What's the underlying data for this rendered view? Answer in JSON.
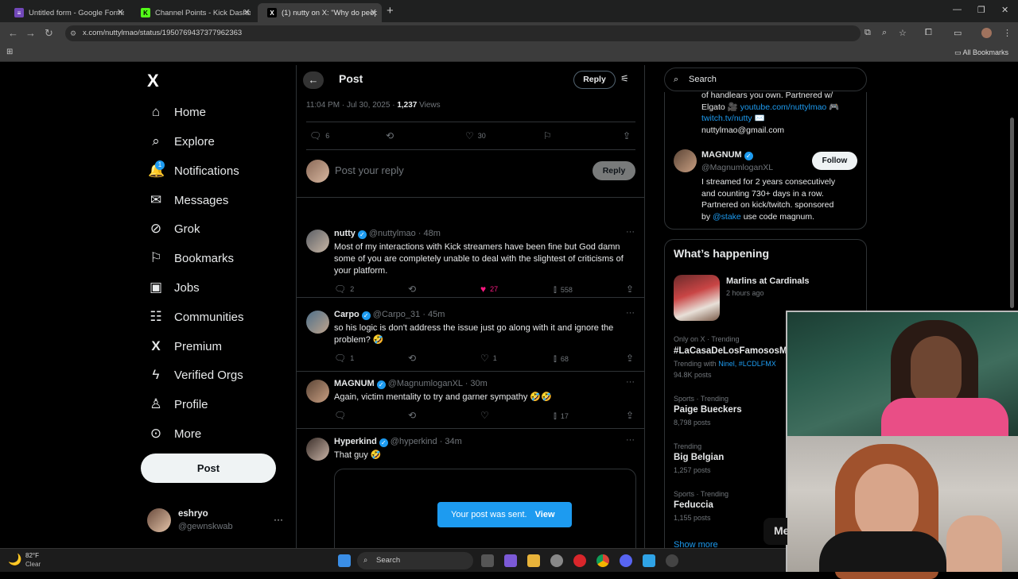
{
  "browser": {
    "tabs": [
      {
        "label": "Untitled form - Google Forms",
        "color": "#7248b9",
        "glyph": "≡"
      },
      {
        "label": "Channel Points - Kick Dashboard",
        "color": "#53fc18",
        "glyph": "K"
      },
      {
        "label": "(1) nutty on X: \"Why do peopl",
        "color": "#000000",
        "glyph": "X"
      }
    ],
    "url": "x.com/nuttylmao/status/1950769437377962363",
    "all_bookmarks": "All Bookmarks"
  },
  "nav": {
    "logo": "X",
    "items": [
      {
        "label": "Home",
        "icon": "home-icon",
        "glyph": "⌂"
      },
      {
        "label": "Explore",
        "icon": "search-icon",
        "glyph": "⌕"
      },
      {
        "label": "Notifications",
        "icon": "bell-icon",
        "glyph": "🔔"
      },
      {
        "label": "Messages",
        "icon": "mail-icon",
        "glyph": "✉"
      },
      {
        "label": "Grok",
        "icon": "grok-icon",
        "glyph": "⊘"
      },
      {
        "label": "Bookmarks",
        "icon": "bookmark-icon",
        "glyph": "⚐"
      },
      {
        "label": "Jobs",
        "icon": "briefcase-icon",
        "glyph": "▣"
      },
      {
        "label": "Communities",
        "icon": "people-icon",
        "glyph": "☷"
      },
      {
        "label": "Premium",
        "icon": "x-icon",
        "glyph": "X"
      },
      {
        "label": "Verified Orgs",
        "icon": "lightning-icon",
        "glyph": "ϟ"
      },
      {
        "label": "Profile",
        "icon": "user-icon",
        "glyph": "♙"
      },
      {
        "label": "More",
        "icon": "more-circle-icon",
        "glyph": "⊙"
      }
    ],
    "notif_count": "1",
    "post_label": "Post",
    "account": {
      "name": "eshryo",
      "handle": "@gewnskwab"
    }
  },
  "header": {
    "title": "Post",
    "reply_label": "Reply"
  },
  "post": {
    "timestamp": "11:04 PM · Jul 30, 2025 · ",
    "views_count": "1,237",
    "views_label": " Views",
    "replies": "6",
    "likes": "30"
  },
  "composer": {
    "placeholder": "Post your reply",
    "reply_label": "Reply"
  },
  "replies": [
    {
      "name": "nutty",
      "handle": "@nuttylmao · 48m",
      "text": "Most of my interactions with Kick streamers have been fine but God damn some of you are completely unable to deal with the slightest of criticisms of your platform.",
      "replies": "2",
      "likes": "27",
      "views": "558",
      "liked": true
    },
    {
      "name": "Carpo",
      "handle": "@Carpo_31 · 45m",
      "text": "so his logic is don't address the issue just go along with it and ignore the problem? 🤣",
      "replies": "1",
      "likes": "1",
      "views": "68",
      "liked": false
    },
    {
      "name": "MAGNUM",
      "handle": "@MagnumloganXL · 30m",
      "text": "Again, victim mentality to try and garner sympathy 🤣🤣",
      "replies": "",
      "likes": "",
      "views": "17",
      "liked": false
    },
    {
      "name": "Hyperkind",
      "handle": "@hyperkind · 34m",
      "text": "That guy 🤣",
      "replies": "",
      "likes": "",
      "views": "",
      "liked": false
    }
  ],
  "toast": {
    "text": "Your post was sent.",
    "action": "View"
  },
  "sidebar": {
    "search_placeholder": "Search",
    "bio_top": {
      "line1": "of handlears you own. Partnered w/",
      "line2_prefix": "Elgato 🎥 ",
      "line2_link": "youtube.com/nuttylmao",
      "line2_suffix": " 🎮",
      "line3_link": "twitch.tv/nutty",
      "line3_suffix": " ✉️",
      "line4": "nuttylmao@gmail.com"
    },
    "magnum": {
      "name": "MAGNUM",
      "handle": "@MagnumloganXL",
      "follow": "Follow",
      "bio_line1": "I streamed for 2 years consecutively",
      "bio_line2": "and counting 730+ days in a row.",
      "bio_line3": "Partnered on kick/twitch. sponsored",
      "bio_line4_prefix": "by ",
      "bio_line4_link": "@stake",
      "bio_line4_suffix": " use code magnum."
    },
    "whats_happening": "What’s happening",
    "event": {
      "title": "Marlins at Cardinals",
      "time": "2 hours ago"
    },
    "trends": [
      {
        "category": "Only on X · Trending",
        "name": "#LaCasaDeLosFamososMx",
        "extra_prefix": "Trending with ",
        "extra_link": "Ninel, #LCDLFMX",
        "count": "94.8K posts"
      },
      {
        "category": "Sports · Trending",
        "name": "Paige Bueckers",
        "count": "8,798 posts"
      },
      {
        "category": "Trending",
        "name": "Big Belgian",
        "count": "1,257 posts"
      },
      {
        "category": "Sports · Trending",
        "name": "Feduccia",
        "count": "1,155 posts"
      }
    ],
    "show_more": "Show more"
  },
  "taskbar": {
    "weather_temp": "82°F",
    "weather_desc": "Clear",
    "search": "Search"
  },
  "overlay_text": "Me",
  "colors": {
    "accent": "#1d9bf0",
    "like": "#f91880",
    "bg": "#000000",
    "border": "#2f3336"
  }
}
